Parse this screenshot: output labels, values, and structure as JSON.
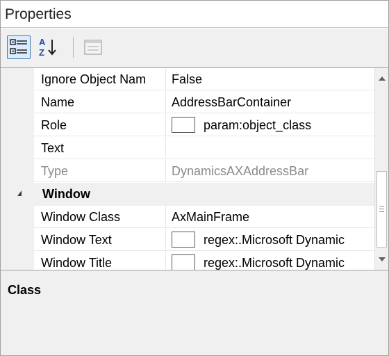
{
  "window": {
    "title": "Properties"
  },
  "toolbar": {
    "categorized_icon": "categorized-view-icon",
    "alphabetical_icon": "sort-alphabetical-icon",
    "property_pages_icon": "property-pages-icon"
  },
  "grid": {
    "rows": [
      {
        "name": "Ignore Object Nam",
        "value": "False"
      },
      {
        "name": "Name",
        "value": "AddressBarContainer"
      },
      {
        "name": "Role",
        "value": "param:object_class",
        "swatch": true
      },
      {
        "name": "Text",
        "value": ""
      },
      {
        "name": "Type",
        "value": "DynamicsAXAddressBar",
        "readonly": true
      }
    ],
    "category": {
      "label": "Window",
      "expanded": true
    },
    "window_rows": [
      {
        "name": "Window Class",
        "value": "AxMainFrame"
      },
      {
        "name": "Window Text",
        "value": "regex:.Microsoft Dynamic",
        "swatch": true
      },
      {
        "name": "Window Title",
        "value": "regex:.Microsoft Dynamic",
        "swatch": true
      }
    ]
  },
  "description": {
    "title": "Class"
  }
}
